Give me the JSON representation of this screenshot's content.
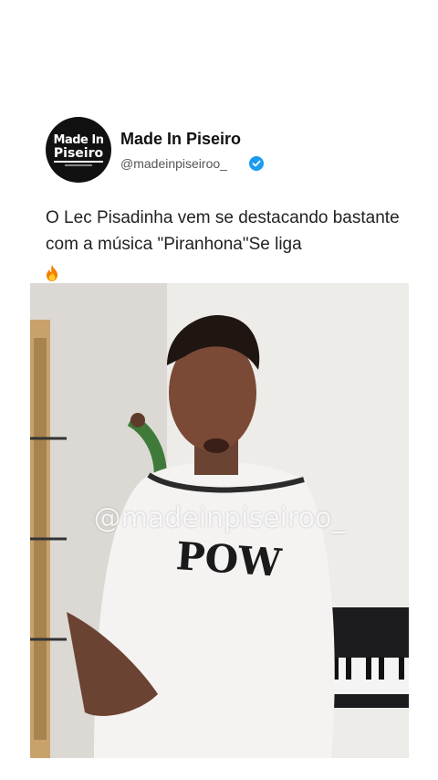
{
  "profile": {
    "avatar_line1": "Made In",
    "avatar_line2": "Piseiro",
    "display_name": "Made In Piseiro",
    "handle": "@madeinpiseiroo_",
    "verified_icon": "verified-badge-icon",
    "accent_color": "#1d9bf0"
  },
  "post": {
    "text": "O  Lec Pisadinha vem se destacando bastante com a música \"Piranhona\"Se liga",
    "emoji_icon": "fire-icon"
  },
  "media": {
    "watermark": "@madeinpiseiroo_",
    "shirt_text": "POW"
  }
}
